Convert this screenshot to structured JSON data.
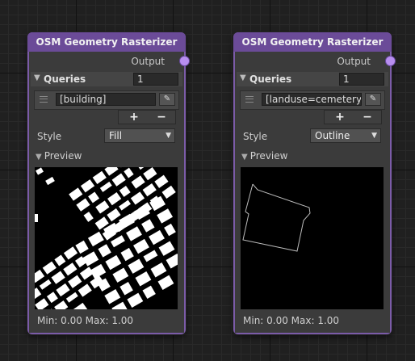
{
  "nodes": [
    {
      "title": "OSM Geometry Rasterizer",
      "output_label": "Output",
      "queries_label": "Queries",
      "query_count": "1",
      "query_value": "[building]",
      "query_button_icon": "pencil-icon",
      "add_label": "+",
      "remove_label": "−",
      "style_label": "Style",
      "style_value": "Fill",
      "preview_label": "Preview",
      "minmax": "Min: 0.00 Max: 1.00"
    },
    {
      "title": "OSM Geometry Rasterizer",
      "output_label": "Output",
      "queries_label": "Queries",
      "query_count": "1",
      "query_value": "[landuse=cemetery]",
      "query_button_icon": "pencil-icon",
      "add_label": "+",
      "remove_label": "−",
      "style_label": "Style",
      "style_value": "Outline",
      "preview_label": "Preview",
      "minmax": "Min: 0.00 Max: 1.00"
    }
  ],
  "colors": {
    "node_frame": "#7b5ba8",
    "node_body": "#3b3b3b",
    "port": "#b88ef0",
    "preview_bg": "#000000",
    "preview_fg": "#ffffff"
  }
}
